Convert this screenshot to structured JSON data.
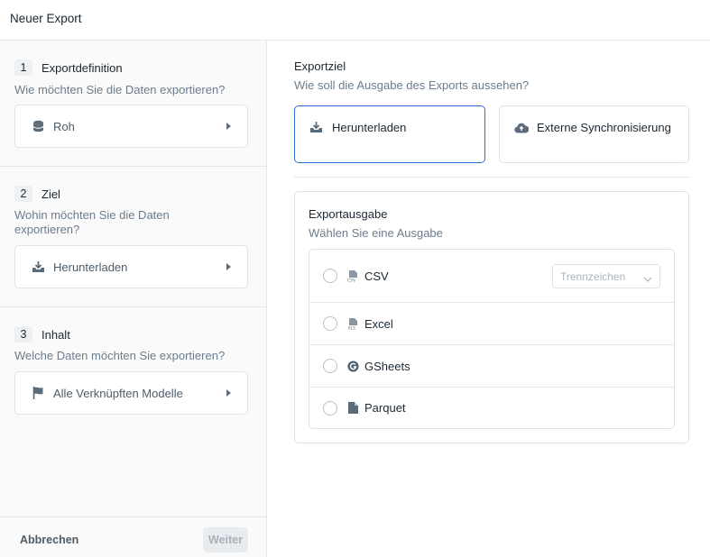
{
  "header": {
    "title": "Neuer Export"
  },
  "sidebar": {
    "steps": [
      {
        "number": "1",
        "title": "Exportdefinition",
        "description": "Wie möchten Sie die Daten exportieren?",
        "selection": "Roh",
        "icon": "database-icon"
      },
      {
        "number": "2",
        "title": "Ziel",
        "description": "Wohin möchten Sie die Daten exportieren?",
        "selection": "Herunterladen",
        "icon": "download-icon"
      },
      {
        "number": "3",
        "title": "Inhalt",
        "description": "Welche Daten möchten Sie exportieren?",
        "selection": "Alle Verknüpften Modelle",
        "icon": "flag-icon"
      }
    ]
  },
  "footer": {
    "cancel_label": "Abbrechen",
    "next_label": "Weiter"
  },
  "main": {
    "destination": {
      "title": "Exportziel",
      "description": "Wie soll die Ausgabe des Exports aussehen?",
      "options": [
        {
          "label": "Herunterladen",
          "icon": "download-icon",
          "selected": true
        },
        {
          "label": "Externe Synchronisierung",
          "icon": "cloud-upload-icon",
          "selected": false
        }
      ]
    },
    "output": {
      "title": "Exportausgabe",
      "description": "Wählen Sie eine Ausgabe",
      "formats": [
        {
          "label": "CSV",
          "icon": "csv-file-icon"
        },
        {
          "label": "Excel",
          "icon": "xls-file-icon"
        },
        {
          "label": "GSheets",
          "icon": "google-icon"
        },
        {
          "label": "Parquet",
          "icon": "file-icon"
        }
      ],
      "separator_placeholder": "Trennzeichen"
    }
  },
  "colors": {
    "accent": "#2f6fd8",
    "border": "#dde2e7",
    "muted_text": "#6b7c8c"
  }
}
